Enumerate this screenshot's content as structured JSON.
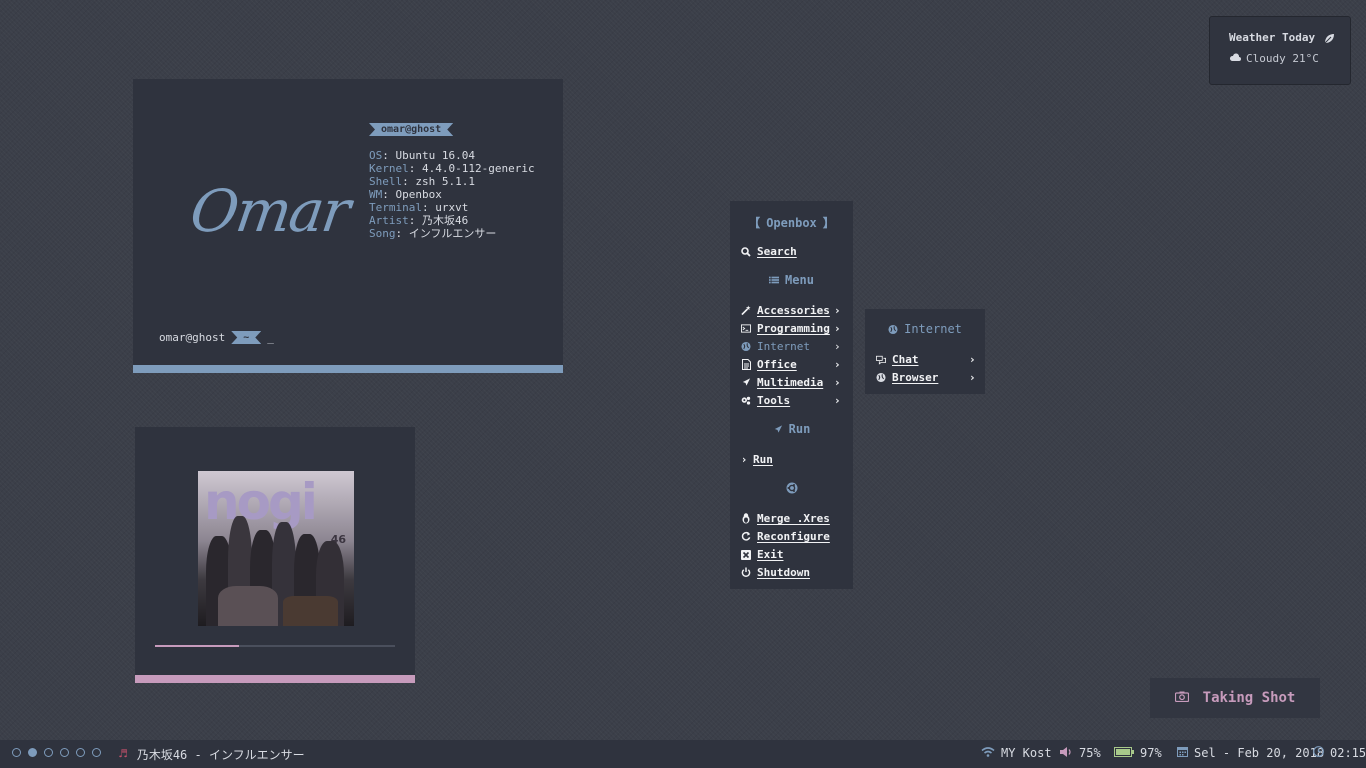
{
  "weather": {
    "title": "Weather Today",
    "condition": "Cloudy 21°C"
  },
  "terminal": {
    "logo": "Omar",
    "user_tag": "omar@ghost",
    "info": [
      {
        "key": "OS",
        "value": "Ubuntu 16.04"
      },
      {
        "key": "Kernel",
        "value": "4.4.0-112-generic"
      },
      {
        "key": "Shell",
        "value": "zsh 5.1.1"
      },
      {
        "key": "WM",
        "value": "Openbox"
      },
      {
        "key": "Terminal",
        "value": "urxvt"
      },
      {
        "key": "Artist",
        "value": "乃木坂46"
      },
      {
        "key": "Song",
        "value": "インフルエンサー"
      }
    ],
    "prompt_user": "omar@ghost",
    "prompt_dir": "~",
    "cursor": "_"
  },
  "music": {
    "album_word": "nogi",
    "album_num": "46",
    "progress": 0.35
  },
  "menu": {
    "header": "Openbox",
    "search": "Search",
    "menu_header": "Menu",
    "items": [
      {
        "label": "Accessories",
        "icon": "wand-icon"
      },
      {
        "label": "Programming",
        "icon": "terminal-icon"
      },
      {
        "label": "Internet",
        "icon": "globe-icon"
      },
      {
        "label": "Office",
        "icon": "document-icon"
      },
      {
        "label": "Multimedia",
        "icon": "rocket-icon"
      },
      {
        "label": "Tools",
        "icon": "gears-icon"
      }
    ],
    "run_header": "Run",
    "run_item": "Run",
    "system_items": [
      {
        "label": "Merge .Xres",
        "icon": "linux-icon"
      },
      {
        "label": "Reconfigure",
        "icon": "refresh-icon"
      },
      {
        "label": "Exit",
        "icon": "close-icon"
      },
      {
        "label": "Shutdown",
        "icon": "power-icon"
      }
    ]
  },
  "submenu": {
    "header": "Internet",
    "items": [
      {
        "label": "Chat",
        "icon": "chat-icon"
      },
      {
        "label": "Browser",
        "icon": "globe-icon"
      }
    ]
  },
  "shot": {
    "label": "Taking Shot"
  },
  "taskbar": {
    "workspaces": 6,
    "active_workspace": 2,
    "now_playing": "乃木坂46 - インフルエンサー",
    "wifi": "MY Kost",
    "volume": "75%",
    "battery": "97%",
    "date": "Sel - Feb 20, 2018",
    "time": "02:15"
  },
  "colors": {
    "accent": "#7e9cbc",
    "pink": "#c79bbc",
    "panel": "#2f333e",
    "bg": "#3b3f49"
  }
}
